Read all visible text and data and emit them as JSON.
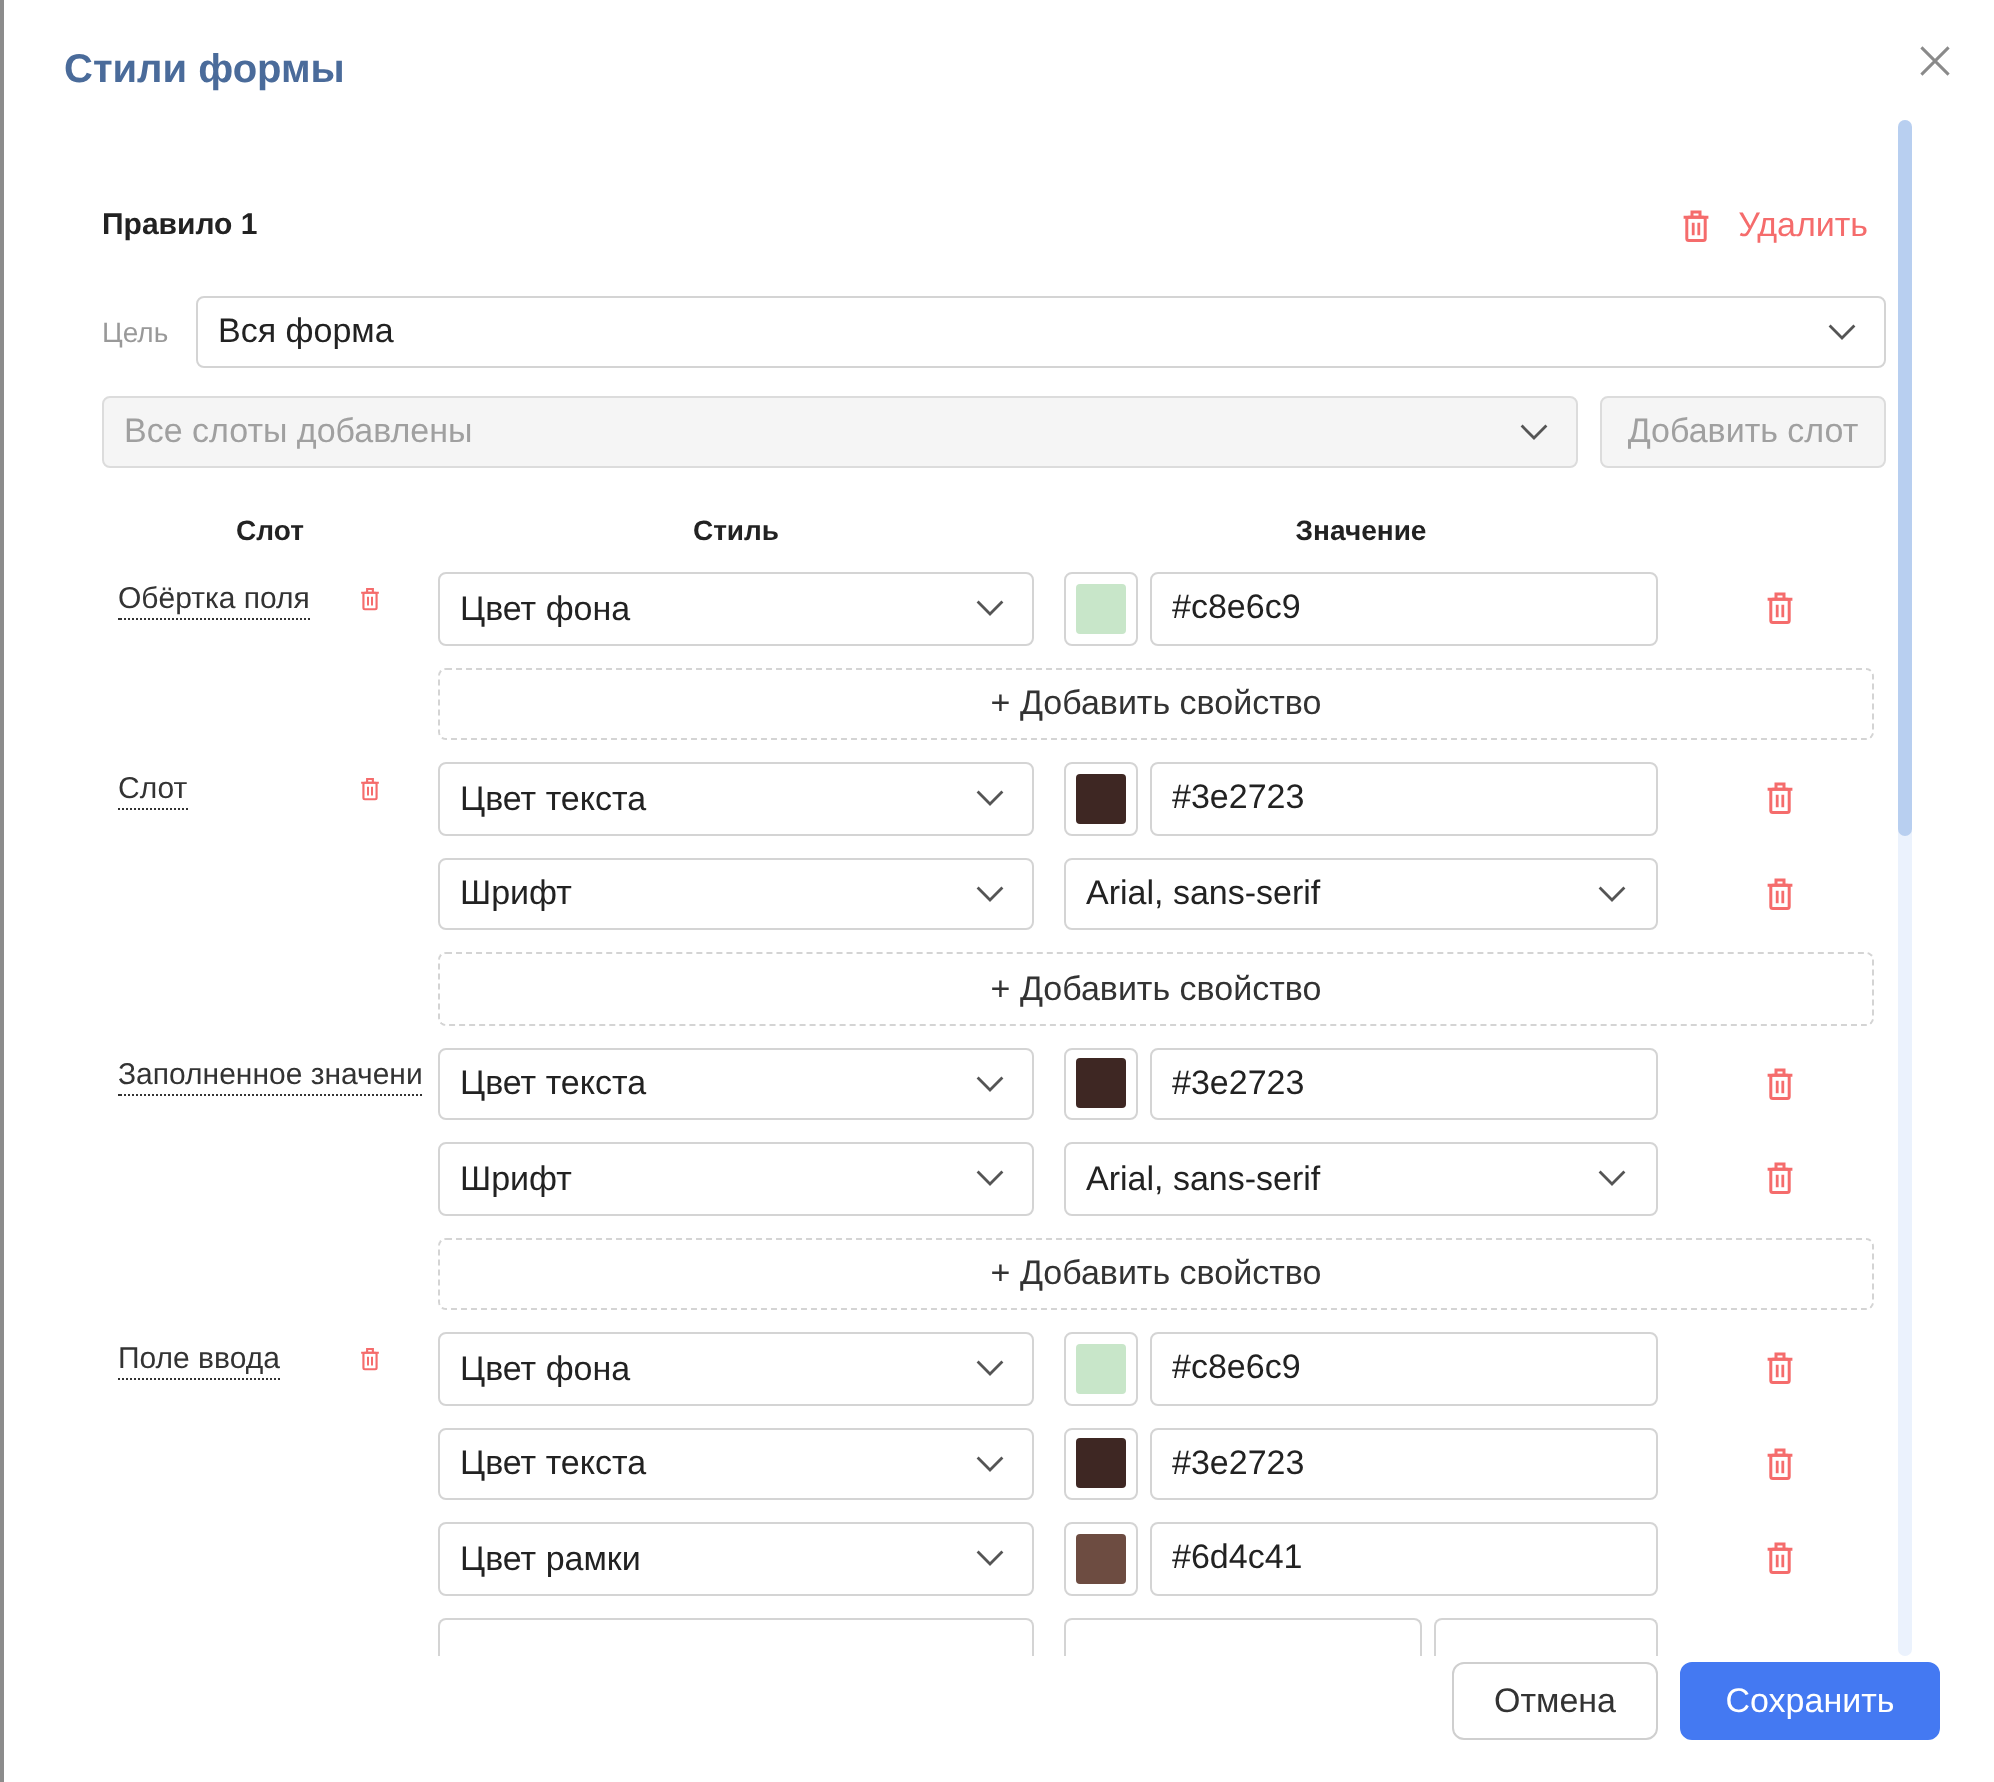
{
  "dialog": {
    "title": "Стили формы"
  },
  "rule": {
    "title": "Правило 1",
    "delete_label": "Удалить",
    "target": {
      "label": "Цель",
      "value": "Вся форма"
    },
    "slot_picker": {
      "placeholder": "Все слоты добавлены",
      "disabled": true
    },
    "add_slot": {
      "label": "Добавить слот",
      "disabled": true
    },
    "columns": [
      "Слот",
      "Стиль",
      "Значение"
    ],
    "groups": [
      {
        "slot": "Обёртка поля",
        "delete_icon": true,
        "properties": [
          {
            "kind": "color",
            "style": "Цвет фона",
            "value": "#c8e6c9",
            "color": "#c8e6c9"
          }
        ],
        "add_label": "+ Добавить свойство"
      },
      {
        "slot": "Слот",
        "delete_icon": true,
        "properties": [
          {
            "kind": "color",
            "style": "Цвет текста",
            "value": "#3e2723",
            "color": "#3e2723"
          },
          {
            "kind": "font",
            "style": "Шрифт",
            "value": "Arial, sans-serif"
          }
        ],
        "add_label": "+ Добавить свойство"
      },
      {
        "slot": "Заполненное значени",
        "delete_icon": false,
        "properties": [
          {
            "kind": "color",
            "style": "Цвет текста",
            "value": "#3e2723",
            "color": "#3e2723"
          },
          {
            "kind": "font",
            "style": "Шрифт",
            "value": "Arial, sans-serif"
          }
        ],
        "add_label": "+ Добавить свойство"
      },
      {
        "slot": "Поле ввода",
        "delete_icon": true,
        "properties": [
          {
            "kind": "color",
            "style": "Цвет фона",
            "value": "#c8e6c9",
            "color": "#c8e6c9"
          },
          {
            "kind": "color",
            "style": "Цвет текста",
            "value": "#3e2723",
            "color": "#3e2723"
          },
          {
            "kind": "color",
            "style": "Цвет рамки",
            "value": "#6d4c41",
            "color": "#6d4c41"
          },
          {
            "kind": "partial"
          }
        ]
      }
    ]
  },
  "footer": {
    "buttons": [
      {
        "label": "Отмена",
        "kind": "secondary"
      },
      {
        "label": "Сохранить",
        "kind": "primary"
      }
    ]
  }
}
